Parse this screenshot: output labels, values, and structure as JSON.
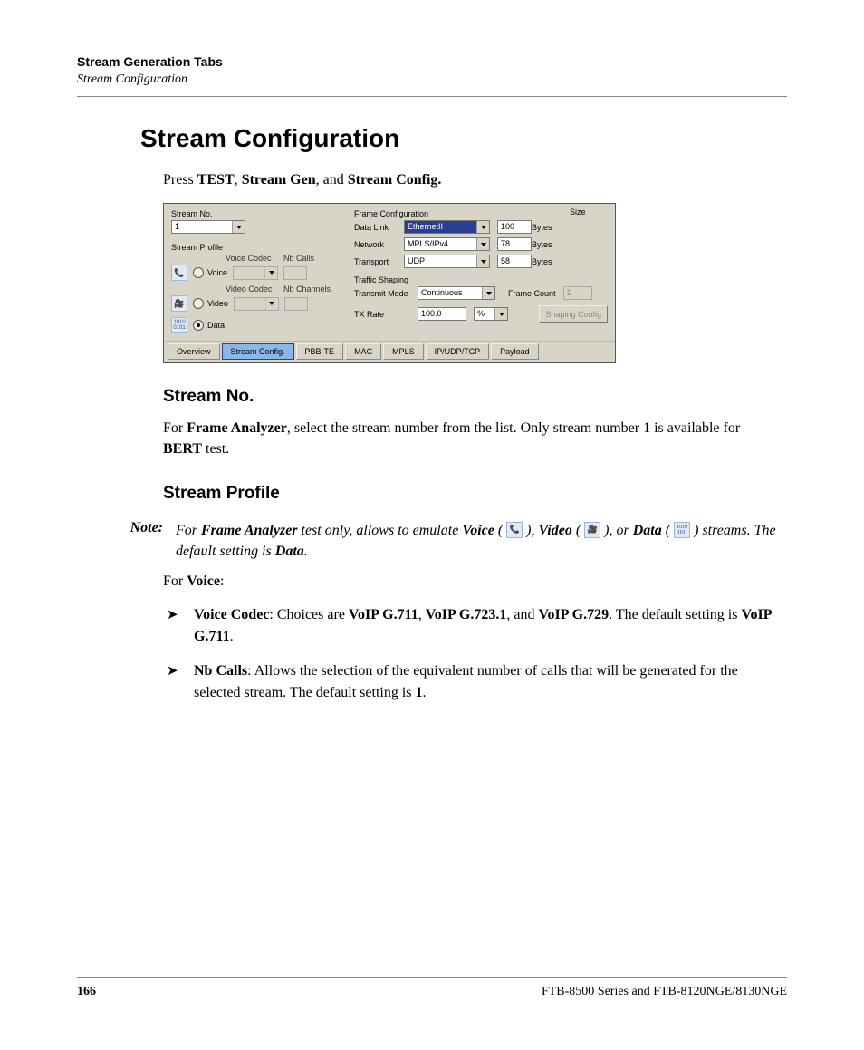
{
  "header": {
    "chapter": "Stream Generation Tabs",
    "section": "Stream Configuration"
  },
  "title": "Stream Configuration",
  "intro": {
    "pre": "Press ",
    "b1": "TEST",
    "sep1": ", ",
    "b2": "Stream Gen",
    "sep2": ", and ",
    "b3": "Stream Config."
  },
  "shot": {
    "stream_no": {
      "label": "Stream No.",
      "value": "1"
    },
    "profile_label": "Stream Profile",
    "cols": {
      "voice_codec": "Voice Codec",
      "nb_calls": "Nb Calls",
      "video_codec": "Video Codec",
      "nb_channels": "Nb Channels"
    },
    "rows": {
      "voice": "Voice",
      "video": "Video",
      "data": "Data"
    },
    "frame": {
      "group": "Frame Configuration",
      "size": "Size",
      "data_link": {
        "label": "Data Link",
        "value": "EthernetII",
        "size": "100",
        "unit": "Bytes"
      },
      "network": {
        "label": "Network",
        "value": "MPLS/IPv4",
        "size": "78",
        "unit": "Bytes"
      },
      "transport": {
        "label": "Transport",
        "value": "UDP",
        "size": "58",
        "unit": "Bytes"
      }
    },
    "shaping": {
      "group": "Traffic Shaping",
      "mode_label": "Transmit Mode",
      "mode_value": "Continuous",
      "frame_count": "Frame Count",
      "frame_count_val": "1",
      "tx_label": "TX Rate",
      "tx_value": "100.0",
      "tx_unit": "%",
      "btn": "Shaping Config"
    },
    "tabs": [
      "Overview",
      "Stream Config.",
      "PBB-TE",
      "MAC",
      "MPLS",
      "IP/UDP/TCP",
      "Payload"
    ]
  },
  "sec_stream_no": {
    "heading": "Stream No.",
    "p_pre": "For ",
    "p_b1": "Frame Analyzer",
    "p_mid": ", select the stream number from the list. Only stream number 1 is available for ",
    "p_b2": "BERT",
    "p_post": " test."
  },
  "sec_profile": {
    "heading": "Stream Profile"
  },
  "note": {
    "label": "Note:",
    "t1": "For ",
    "b1": "Frame Analyzer",
    "t2": " test only, allows to emulate ",
    "b2": "Voice",
    "t3": " ( ",
    "t3b": " ), ",
    "b3": "Video",
    "t4": " ( ",
    "t4b": " ), or ",
    "b4": "Data",
    "t5": " ( ",
    "t5b": " ) streams. The default setting is ",
    "b5": "Data",
    "t6": "."
  },
  "for_voice": {
    "pre": "For ",
    "b": "Voice",
    "post": ":"
  },
  "bullets": {
    "b1": {
      "lead": "Voice Codec",
      "t1": ": Choices are ",
      "c1": "VoIP G.711",
      "t2": ", ",
      "c2": "VoIP G.723.1",
      "t3": ", and ",
      "c3": "VoIP G.729",
      "t4": ". The default setting is ",
      "c4": "VoIP G.711",
      "t5": "."
    },
    "b2": {
      "lead": "Nb Calls",
      "t1": ": Allows the selection of the equivalent number of calls that will be generated for the selected stream. The default setting is ",
      "c1": "1",
      "t2": "."
    }
  },
  "footer": {
    "page": "166",
    "doc": "FTB-8500 Series and FTB-8120NGE/8130NGE"
  }
}
